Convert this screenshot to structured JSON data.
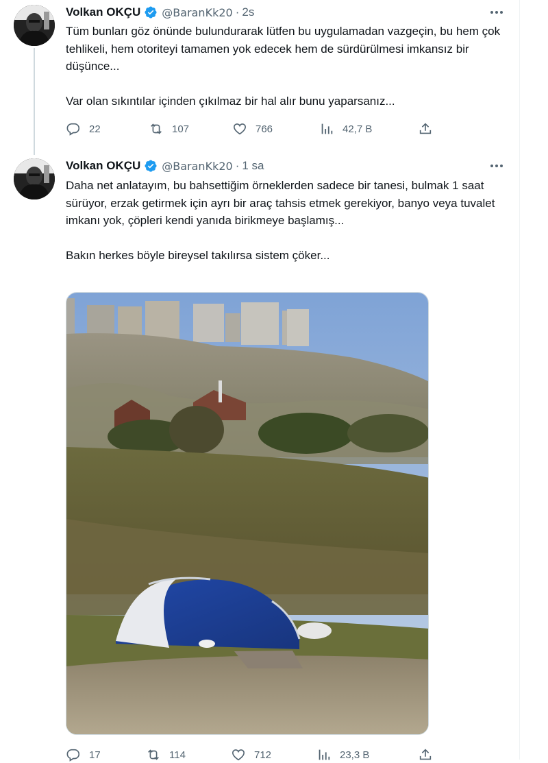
{
  "tweets": [
    {
      "author": {
        "name": "Volkan OKÇU",
        "handle": "@BaranKk20",
        "verified": true,
        "avatar_icon": "avatar-photo"
      },
      "time": "2s",
      "paragraphs": [
        "Tüm bunları göz önünde bulundurarak lütfen bu uygulamadan vazgeçin, bu hem çok tehlikeli, hem otoriteyi tamamen yok edecek hem de sürdürülmesi imkansız bir düşünce...",
        "Var olan sıkıntılar içinden çıkılmaz bir hal alır bunu yaparsanız..."
      ],
      "stats": {
        "replies": "22",
        "retweets": "107",
        "likes": "766",
        "views": "42,7 B"
      }
    },
    {
      "author": {
        "name": "Volkan OKÇU",
        "handle": "@BaranKk20",
        "verified": true,
        "avatar_icon": "avatar-photo"
      },
      "time": "1 sa",
      "paragraphs": [
        "Daha net anlatayım, bu bahsettiğim örneklerden sadece bir tanesi, bulmak 1 saat sürüyor, erzak getirmek için ayrı bir araç tahsis etmek gerekiyor, banyo veya tuvalet imkanı yok, çöpleri kendi yanıda birikmeye başlamış...",
        "Bakın herkes böyle bireysel takılırsa sistem çöker..."
      ],
      "media": {
        "type": "photo",
        "description_icon": "tent-on-hillside-photo"
      },
      "stats": {
        "replies": "17",
        "retweets": "114",
        "likes": "712",
        "views": "23,3 B"
      }
    }
  ],
  "colors": {
    "text": "#0f1419",
    "secondary": "#536471",
    "verified": "#1d9bf0",
    "border": "#eff3f4"
  },
  "icons": {
    "reply": "reply-icon",
    "retweet": "retweet-icon",
    "like": "like-icon",
    "views": "views-icon",
    "share": "share-icon",
    "more": "more-icon",
    "verified": "verified-badge-icon"
  }
}
